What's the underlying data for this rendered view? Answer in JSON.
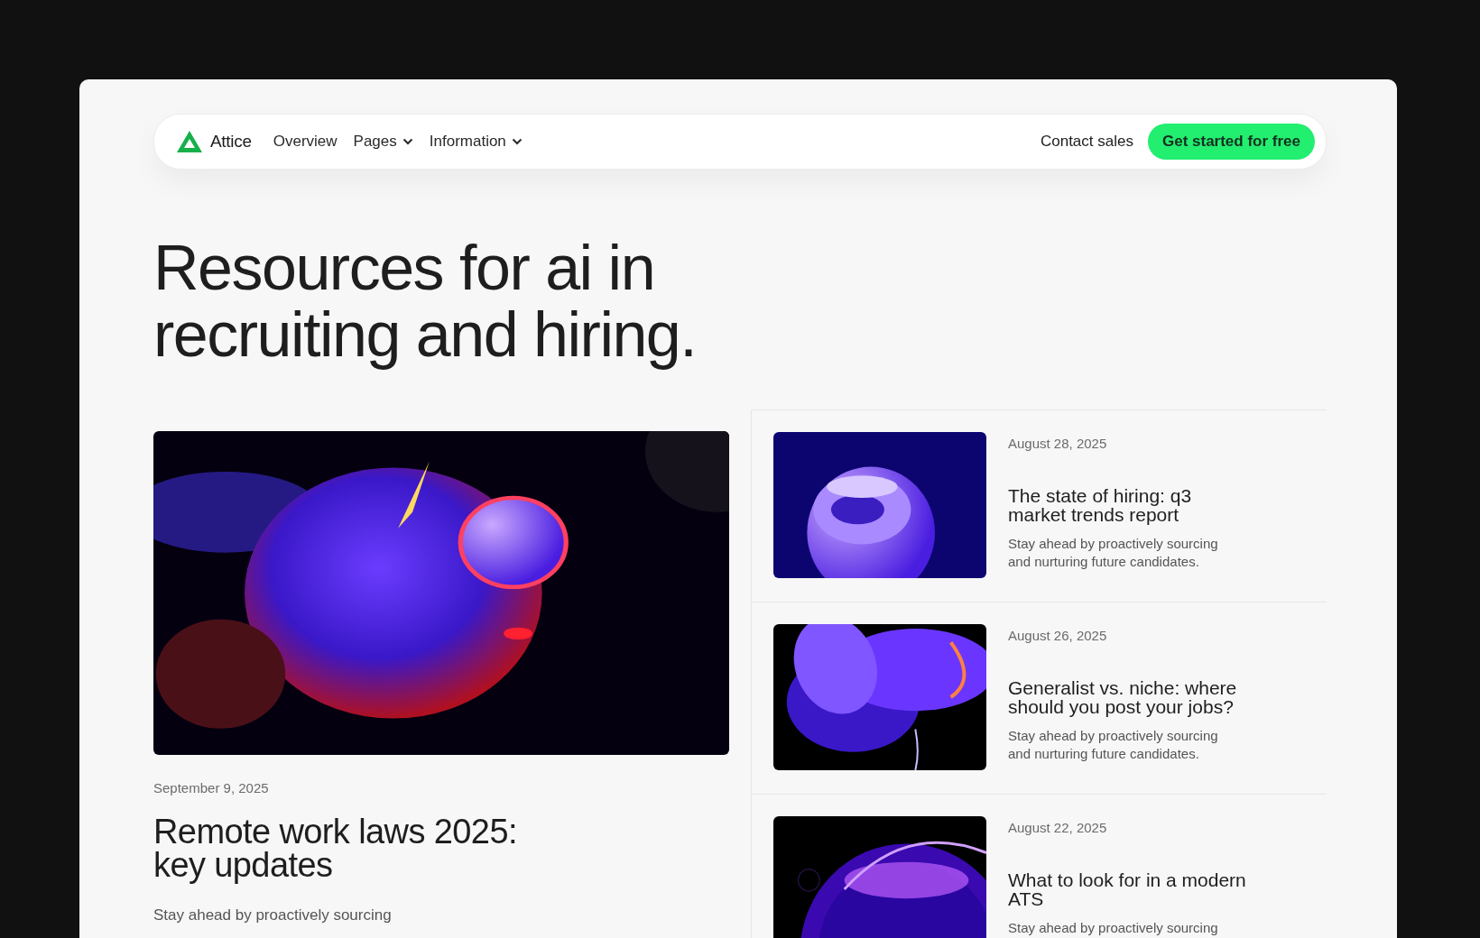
{
  "nav": {
    "brand": "Attice",
    "links": [
      {
        "label": "Overview",
        "dropdown": false
      },
      {
        "label": "Pages",
        "dropdown": true
      },
      {
        "label": "Information",
        "dropdown": true
      }
    ],
    "contact": "Contact sales",
    "cta": "Get started for free"
  },
  "hero": {
    "title": "Resources for ai in recruiting and hiring."
  },
  "featured": {
    "date": "September 9, 2025",
    "title": "Remote work laws 2025: key updates",
    "summary": "Stay ahead by proactively sourcing"
  },
  "articles": [
    {
      "date": "August 28, 2025",
      "title": "The state of hiring: q3 market trends report",
      "summary": "Stay ahead by proactively sourcing and nurturing future candidates."
    },
    {
      "date": "August 26, 2025",
      "title": "Generalist vs. niche: where should you post your jobs?",
      "summary": "Stay ahead by proactively sourcing and nurturing future candidates."
    },
    {
      "date": "August 22, 2025",
      "title": "What to look for in a modern ATS",
      "summary": "Stay ahead by proactively sourcing"
    }
  ]
}
